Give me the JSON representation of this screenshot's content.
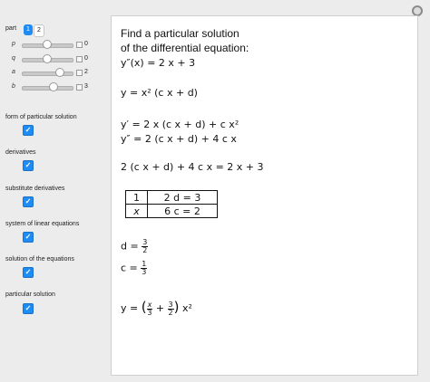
{
  "controls": {
    "part_label": "part",
    "part_tabs": [
      "1",
      "2"
    ],
    "sliders": [
      {
        "name": "p",
        "value": "0",
        "level": 0.5
      },
      {
        "name": "q",
        "value": "0",
        "level": 0.5
      },
      {
        "name": "a",
        "value": "2",
        "level": 0.75
      },
      {
        "name": "b",
        "value": "3",
        "level": 0.6
      }
    ],
    "checkboxes": [
      {
        "label": "form of particular solution",
        "checked": "✓"
      },
      {
        "label": "derivatives",
        "checked": "✓"
      },
      {
        "label": "substitute derivatives",
        "checked": "✓"
      },
      {
        "label": "system of linear equations",
        "checked": "✓"
      },
      {
        "label": "solution of the equations",
        "checked": "✓"
      },
      {
        "label": "particular solution",
        "checked": "✓"
      }
    ]
  },
  "display": {
    "heading_line1": "Find a particular solution",
    "heading_line2": "of the differential equation:",
    "ode": "y″(x) = 2 x + 3",
    "form": "y = x² (c x + d)",
    "deriv1": "y′ = 2 x (c x + d) + c x²",
    "deriv2": "y″ = 2 (c x + d) + 4 c x",
    "substituted": "2 (c x + d) + 4 c x = 2 x + 3",
    "system": [
      {
        "coef": "1",
        "eq": "2 d = 3"
      },
      {
        "coef": "x",
        "eq": "6 c = 2"
      }
    ],
    "sol_d_lhs": "d =",
    "sol_d_num": "3",
    "sol_d_den": "2",
    "sol_c_lhs": "c =",
    "sol_c_num": "1",
    "sol_c_den": "3",
    "final_lhs": "y =",
    "final_t1_num": "x",
    "final_t1_den": "3",
    "final_plus": "+",
    "final_t2_num": "3",
    "final_t2_den": "2",
    "final_tail": "x²",
    "open_paren": "(",
    "close_paren": ")"
  },
  "colors": {
    "checkbox": "#1e8cf4",
    "selected_tab": "#1e8cf4"
  }
}
